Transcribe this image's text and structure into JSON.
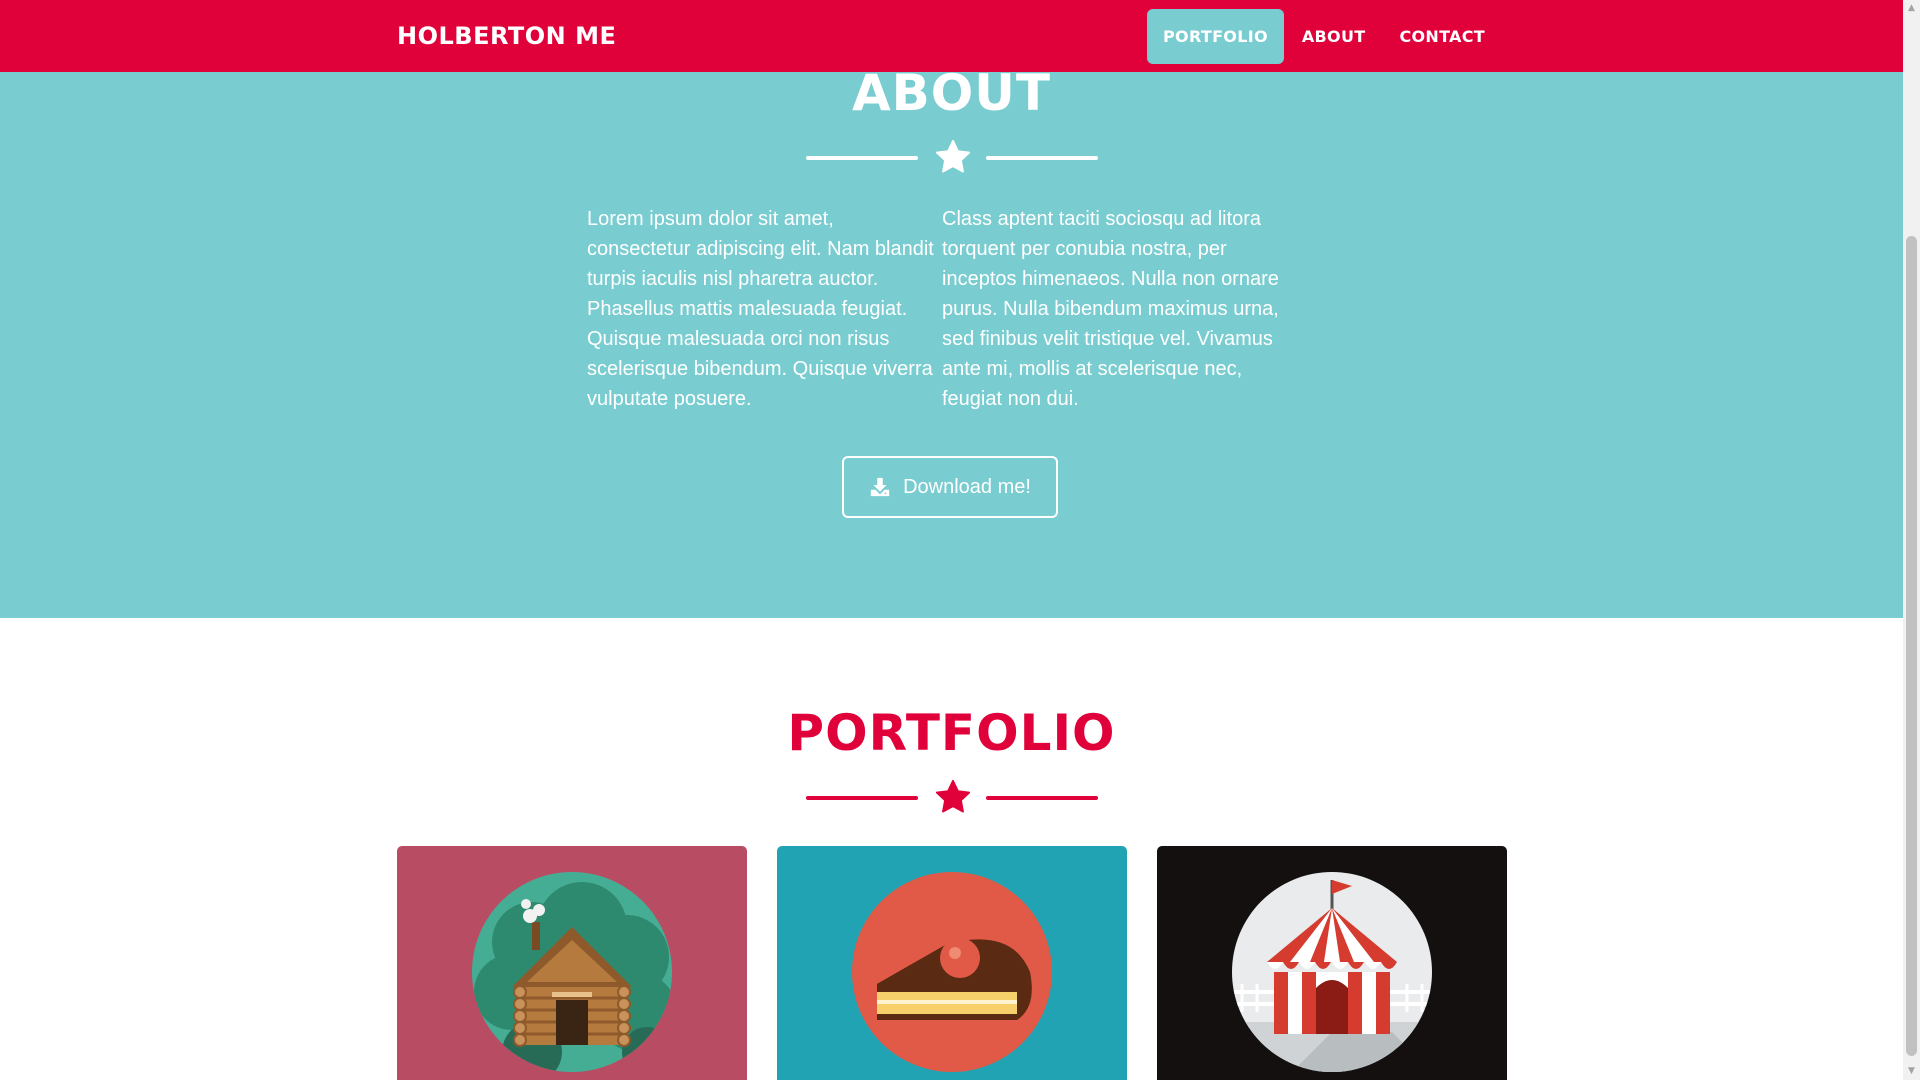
{
  "navbar": {
    "brand": "HOLBERTON ME",
    "items": [
      {
        "label": "PORTFOLIO",
        "active": true
      },
      {
        "label": "ABOUT",
        "active": false
      },
      {
        "label": "CONTACT",
        "active": false
      }
    ]
  },
  "about": {
    "title": "ABOUT",
    "col1": "Lorem ipsum dolor sit amet, consectetur adipiscing elit. Nam blandit turpis iaculis nisl pharetra auctor. Phasellus mattis malesuada feugiat. Quisque malesuada orci non risus scelerisque bibendum. Quisque viverra vulputate posuere.",
    "col2": "Class aptent taciti sociosqu ad litora torquent per conubia nostra, per inceptos himenaeos. Nulla non ornare purus. Nulla bibendum maximus urna, sed finibus velit tristique vel. Vivamus ante mi, mollis at scelerisque nec, feugiat non dui.",
    "download_label": "Download me!"
  },
  "portfolio": {
    "title": "PORTFOLIO",
    "cards": [
      {
        "icon": "cabin-icon",
        "bg": "#b84c62"
      },
      {
        "icon": "cake-icon",
        "bg": "#21a3b3"
      },
      {
        "icon": "circus-tent-icon",
        "bg": "#141010"
      }
    ]
  },
  "colors": {
    "brand": "#e0003a",
    "teal": "#79ccd0",
    "white": "#ffffff"
  }
}
